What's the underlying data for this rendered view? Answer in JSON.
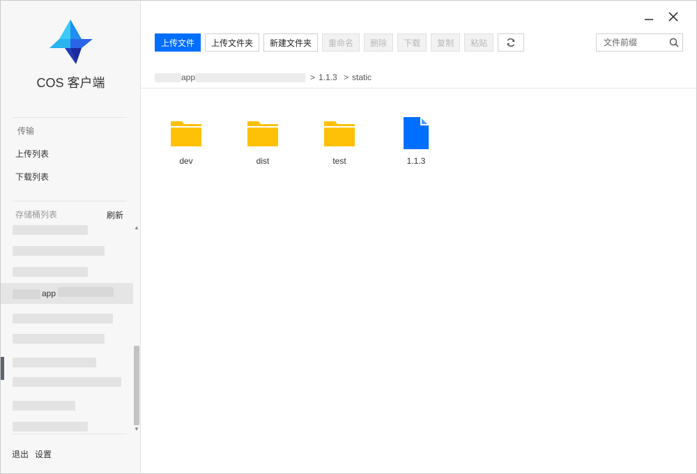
{
  "app": {
    "title": "COS 客户端"
  },
  "sidebar": {
    "transfer_label": "传输",
    "upload_list": "上传列表",
    "download_list": "下载列表",
    "bucket_list_label": "存储桶列表",
    "refresh": "刷新",
    "active_bucket_label": "app",
    "logout": "退出",
    "settings": "设置"
  },
  "toolbar": {
    "upload_file": "上传文件",
    "upload_folder": "上传文件夹",
    "new_folder": "新建文件夹",
    "rename": "重命名",
    "delete": "删除",
    "download": "下载",
    "copy": "复制",
    "paste": "粘贴",
    "refresh_icon": "refresh-icon"
  },
  "search": {
    "placeholder": "文件前缀"
  },
  "breadcrumb": {
    "segments": [
      "app",
      "1.1.3",
      "static"
    ],
    "separator": ">"
  },
  "files": [
    {
      "name": "dev",
      "type": "folder"
    },
    {
      "name": "dist",
      "type": "folder"
    },
    {
      "name": "test",
      "type": "folder"
    },
    {
      "name": "1.1.3",
      "type": "file"
    }
  ],
  "colors": {
    "primary": "#006eff",
    "folder": "#ffc107",
    "file": "#006eff"
  }
}
